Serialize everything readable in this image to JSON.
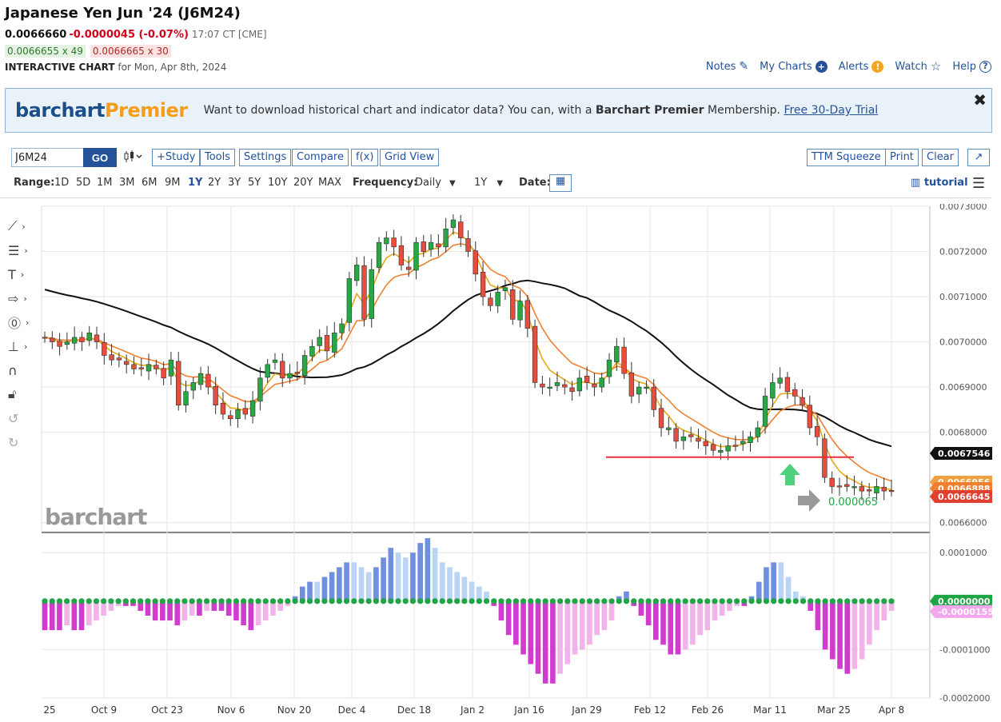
{
  "header": {
    "title": "Japanese Yen Jun '24 (J6M24)",
    "last": "0.0066660",
    "change": "-0.0000045 (-0.07%)",
    "time": "17:07 CT [CME]",
    "bid": "0.0066655 x 49",
    "ask": "0.0066665 x 30",
    "subtitle_bold": "INTERACTIVE CHART",
    "subtitle_rest": "for Mon, Apr 8th, 2024"
  },
  "nav": [
    {
      "label": "Notes",
      "icon": "edit-icon"
    },
    {
      "label": "My Charts",
      "icon": "plus-circle-icon"
    },
    {
      "label": "Alerts",
      "icon": "alert-icon"
    },
    {
      "label": "Watch",
      "icon": "star-icon"
    },
    {
      "label": "Help",
      "icon": "question-icon"
    }
  ],
  "banner": {
    "logo_a": "barchart",
    "logo_b": "Premier",
    "text_a": "Want to download historical chart and indicator data? You can, with a",
    "text_b": "Barchart Premier",
    "text_c": "Membership.",
    "link": "Free 30-Day Trial",
    "close": "✖"
  },
  "toolbar": {
    "symbol": "J6M24",
    "go": "GO",
    "chart_type_icon": "candlestick-icon",
    "buttons": [
      "+Study",
      "Tools",
      "Settings",
      "Compare",
      "f(x)",
      "Grid View"
    ],
    "right_buttons": [
      "TTM Squeeze",
      "Print",
      "Clear",
      "↗"
    ]
  },
  "range": {
    "label": "Range:",
    "options": [
      "1D",
      "5D",
      "1M",
      "3M",
      "6M",
      "9M",
      "1Y",
      "2Y",
      "3Y",
      "5Y",
      "10Y",
      "20Y",
      "MAX"
    ],
    "selected": "1Y",
    "frequency_label": "Frequency:",
    "frequency": "Daily",
    "period": "1Y",
    "date_label": "Date:",
    "tutorial": "tutorial"
  },
  "side_tools": [
    "line-tool-icon",
    "fib-tool-icon",
    "text-tool-icon",
    "arrow-tool-icon",
    "marker-tool-icon",
    "measure-tool-icon",
    "magnet-icon",
    "lock-icon",
    "undo-icon",
    "redo-icon"
  ],
  "watermark": "barchart",
  "chart_data": {
    "type": "candlestick",
    "x_ticks": [
      "25",
      "Oct 9",
      "Oct 23",
      "Nov 6",
      "Nov 20",
      "Dec 4",
      "Dec 18",
      "Jan 2",
      "Jan 16",
      "Jan 29",
      "Feb 12",
      "Feb 26",
      "Mar 11",
      "Mar 25",
      "Apr 8"
    ],
    "y_ticks": [
      "0.0073000",
      "0.0072000",
      "0.0071000",
      "0.0070000",
      "0.0069000",
      "0.0068000",
      "0.0066000"
    ],
    "ylim": [
      0.00658,
      0.0073
    ],
    "price_labels": [
      {
        "value": "0.0067546",
        "color": "#111111"
      },
      {
        "value": "0.0066956",
        "color": "#f0a040"
      },
      {
        "value": "0.0066888",
        "color": "#f08030"
      },
      {
        "value": "0.0066645",
        "color": "#e04030"
      }
    ],
    "annotation": "0.000065",
    "support_level": 0.006745,
    "closes": [
      0.00701,
      0.007,
      0.00699,
      0.007,
      0.00701,
      0.007,
      0.00702,
      0.007,
      0.00697,
      0.00696,
      0.00696,
      0.00695,
      0.00694,
      0.00694,
      0.00695,
      0.00694,
      0.00692,
      0.00696,
      0.00686,
      0.00689,
      0.00691,
      0.00693,
      0.0069,
      0.00686,
      0.00684,
      0.00683,
      0.00685,
      0.00684,
      0.00687,
      0.00692,
      0.00695,
      0.00696,
      0.00692,
      0.00693,
      0.00693,
      0.00697,
      0.00699,
      0.00701,
      0.00698,
      0.00702,
      0.00704,
      0.00714,
      0.00717,
      0.00705,
      0.00716,
      0.00722,
      0.00723,
      0.00721,
      0.00717,
      0.00716,
      0.00722,
      0.0072,
      0.00722,
      0.00721,
      0.00725,
      0.00727,
      0.00723,
      0.0072,
      0.00715,
      0.0071,
      0.00708,
      0.00711,
      0.00712,
      0.00705,
      0.00709,
      0.00703,
      0.00691,
      0.0069,
      0.0069,
      0.00691,
      0.0069,
      0.00689,
      0.00692,
      0.00691,
      0.0069,
      0.00692,
      0.00696,
      0.00699,
      0.00693,
      0.00688,
      0.0069,
      0.0069,
      0.00685,
      0.00681,
      0.00681,
      0.00678,
      0.00679,
      0.00679,
      0.00678,
      0.00677,
      0.00676,
      0.00676,
      0.00677,
      0.00677,
      0.00678,
      0.00679,
      0.00681,
      0.00688,
      0.00691,
      0.00692,
      0.00689,
      0.00688,
      0.00686,
      0.00681,
      0.00679,
      0.0067,
      0.00668,
      0.00668,
      0.00668,
      0.00668,
      0.00667,
      0.00667,
      0.00668,
      0.00667,
      0.00667
    ],
    "ma_values": {
      "ma_fast": 0.0066956,
      "ma_mid": 0.0066888,
      "ma_slow": 0.0067546
    },
    "indicator": {
      "name": "TTM Squeeze",
      "y_ticks": [
        "0.0001000",
        "-0.0001000",
        "-0.0002000"
      ],
      "ylim": [
        -0.0002,
        0.00014
      ],
      "last_label": "-0.0000155",
      "zero_label": "0.0000000",
      "values": [
        -6e-05,
        -6e-05,
        -6e-05,
        -5e-05,
        -6e-05,
        -6e-05,
        -5e-05,
        -4e-05,
        -3e-05,
        -2e-05,
        -1e-05,
        -1e-05,
        -1e-05,
        -2e-05,
        -3e-05,
        -4e-05,
        -4e-05,
        -4e-05,
        -5e-05,
        -4e-05,
        -3e-05,
        -3e-05,
        -2e-05,
        -2e-05,
        -2e-05,
        -3e-05,
        -4e-05,
        -5e-05,
        -6e-05,
        -5e-05,
        -4e-05,
        -3e-05,
        -2e-05,
        -1e-05,
        1e-05,
        3e-05,
        4e-05,
        4e-05,
        5e-05,
        6e-05,
        7e-05,
        8e-05,
        8e-05,
        7e-05,
        6e-05,
        7e-05,
        9e-05,
        0.00011,
        0.0001,
        9e-05,
        0.0001,
        0.00012,
        0.00013,
        0.00011,
        8e-05,
        7e-05,
        6e-05,
        5e-05,
        4e-05,
        3e-05,
        2e-05,
        -1e-05,
        -4e-05,
        -7e-05,
        -9e-05,
        -0.00011,
        -0.00013,
        -0.00015,
        -0.00017,
        -0.00017,
        -0.00015,
        -0.00013,
        -0.00011,
        -0.0001,
        -9e-05,
        -7e-05,
        -6e-05,
        -4e-05,
        1e-05,
        2e-05,
        -1e-05,
        -3e-05,
        -5e-05,
        -8e-05,
        -9e-05,
        -0.00011,
        -0.00011,
        -0.0001,
        -9e-05,
        -7e-05,
        -6e-05,
        -4e-05,
        -3e-05,
        -2e-05,
        -1e-05,
        -1e-05,
        1e-05,
        4e-05,
        7e-05,
        8e-05,
        8e-05,
        5e-05,
        2e-05,
        1e-05,
        -2e-05,
        -6e-05,
        -0.0001,
        -0.00012,
        -0.00014,
        -0.00015,
        -0.00014,
        -0.00012,
        -9e-05,
        -6e-05,
        -4e-05,
        -2e-05
      ]
    }
  },
  "colors": {
    "up": "#27a845",
    "down": "#e74c3c",
    "ma_fast": "#e6a817",
    "ma_mid": "#f08030",
    "ma_slow": "#111111",
    "support": "#e8303a",
    "hist_pos_strong": "#6f8fdf",
    "hist_pos_weak": "#b9d4f5",
    "hist_neg_strong": "#d13ccf",
    "hist_neg_weak": "#f2b3ea",
    "squeeze_dot": "#1fa546"
  }
}
